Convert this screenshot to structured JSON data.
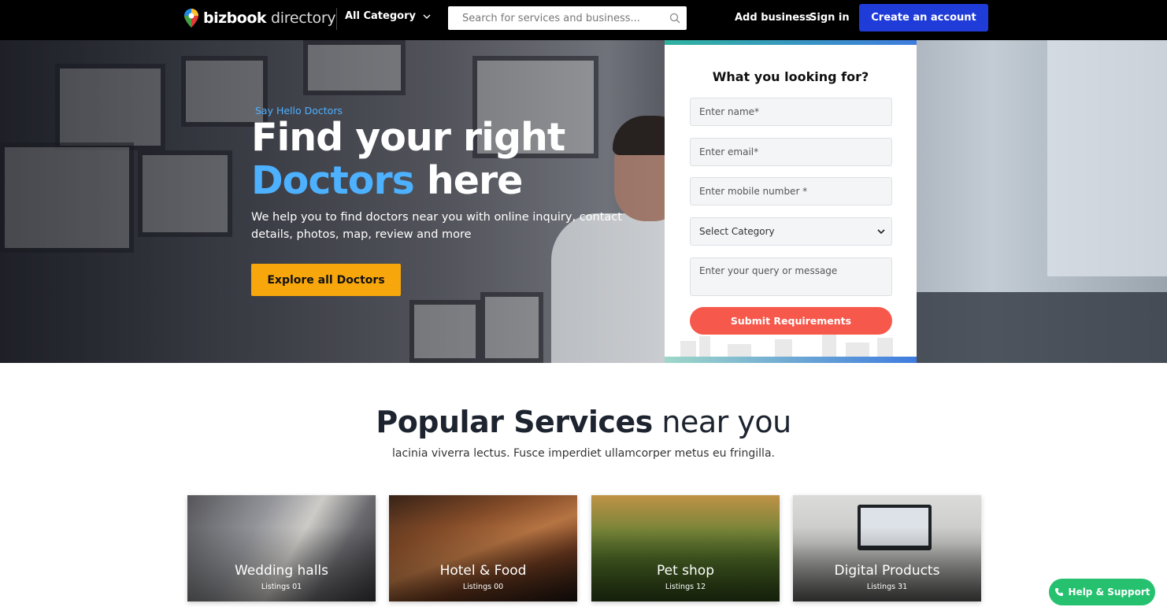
{
  "header": {
    "brand_bold": "bizbook",
    "brand_light": "directory",
    "category_label": "All Category",
    "search_placeholder": "Search for services and business...",
    "add_business": "Add business",
    "sign_in": "Sign in",
    "create_account": "Create an account"
  },
  "hero": {
    "eyebrow": "Say Hello Doctors",
    "title_line1": "Find your right",
    "title_accent": "Doctors",
    "title_rest": " here",
    "description": "We help you to find doctors near you with online inquiry, contact details, photos, map, review and more",
    "explore_button": "Explore all Doctors"
  },
  "form": {
    "title": "What you looking for?",
    "name_placeholder": "Enter name*",
    "email_placeholder": "Enter email*",
    "mobile_placeholder": "Enter mobile number *",
    "category_selected": "Select Category",
    "message_placeholder": "Enter your query or message",
    "submit": "Submit Requirements"
  },
  "popular": {
    "title_bold": "Popular Services",
    "title_light": " near you",
    "subtitle": "lacinia viverra lectus. Fusce imperdiet ullamcorper metus eu fringilla.",
    "cards": [
      {
        "name": "Wedding halls",
        "count": "Listings 01"
      },
      {
        "name": "Hotel & Food",
        "count": "Listings 00"
      },
      {
        "name": "Pet shop",
        "count": "Listings 12"
      },
      {
        "name": "Digital Products",
        "count": "Listings 31"
      }
    ]
  },
  "help": {
    "label": "Help & Support"
  },
  "colors": {
    "accent_blue": "#4db1ff",
    "create_button": "#1f3bd8",
    "explore_button": "#f7a70c",
    "submit_button": "#f6584b",
    "help_button": "#25c16f"
  }
}
